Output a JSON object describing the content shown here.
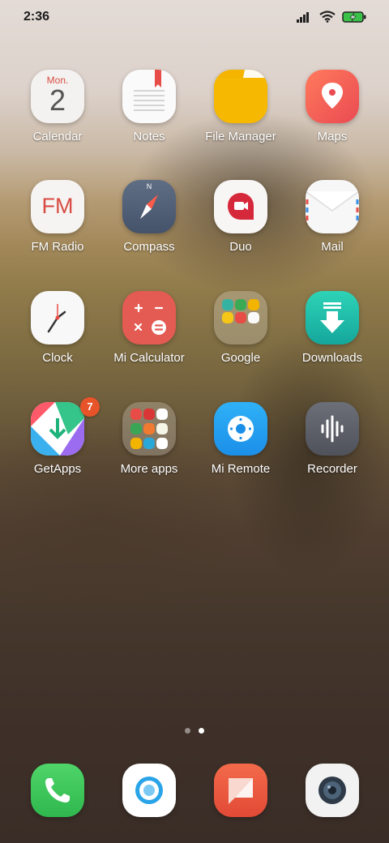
{
  "status_bar": {
    "time": "2:36",
    "icons": [
      "signal-icon",
      "wifi-icon",
      "battery-charging-icon"
    ]
  },
  "apps": [
    {
      "label": "Calendar",
      "month": "Mon.",
      "day": "2"
    },
    {
      "label": "Notes"
    },
    {
      "label": "File Manager"
    },
    {
      "label": "Maps"
    },
    {
      "label": "FM Radio",
      "icon_text": "FM"
    },
    {
      "label": "Compass",
      "icon_text": "N"
    },
    {
      "label": "Duo"
    },
    {
      "label": "Mail"
    },
    {
      "label": "Clock"
    },
    {
      "label": "Mi Calculator"
    },
    {
      "label": "Google"
    },
    {
      "label": "Downloads"
    },
    {
      "label": "GetApps",
      "badge": "7"
    },
    {
      "label": "More apps"
    },
    {
      "label": "Mi Remote"
    },
    {
      "label": "Recorder"
    }
  ],
  "pager": {
    "pages": 2,
    "active_page": 2
  },
  "dock": [
    "phone-icon",
    "browser-icon",
    "messaging-icon",
    "camera-icon"
  ],
  "colors": {
    "accent_red": "#e84c46",
    "file_manager_yellow": "#f4b400",
    "downloads_teal": "#1cbfa8",
    "badge": "#e8542a"
  }
}
